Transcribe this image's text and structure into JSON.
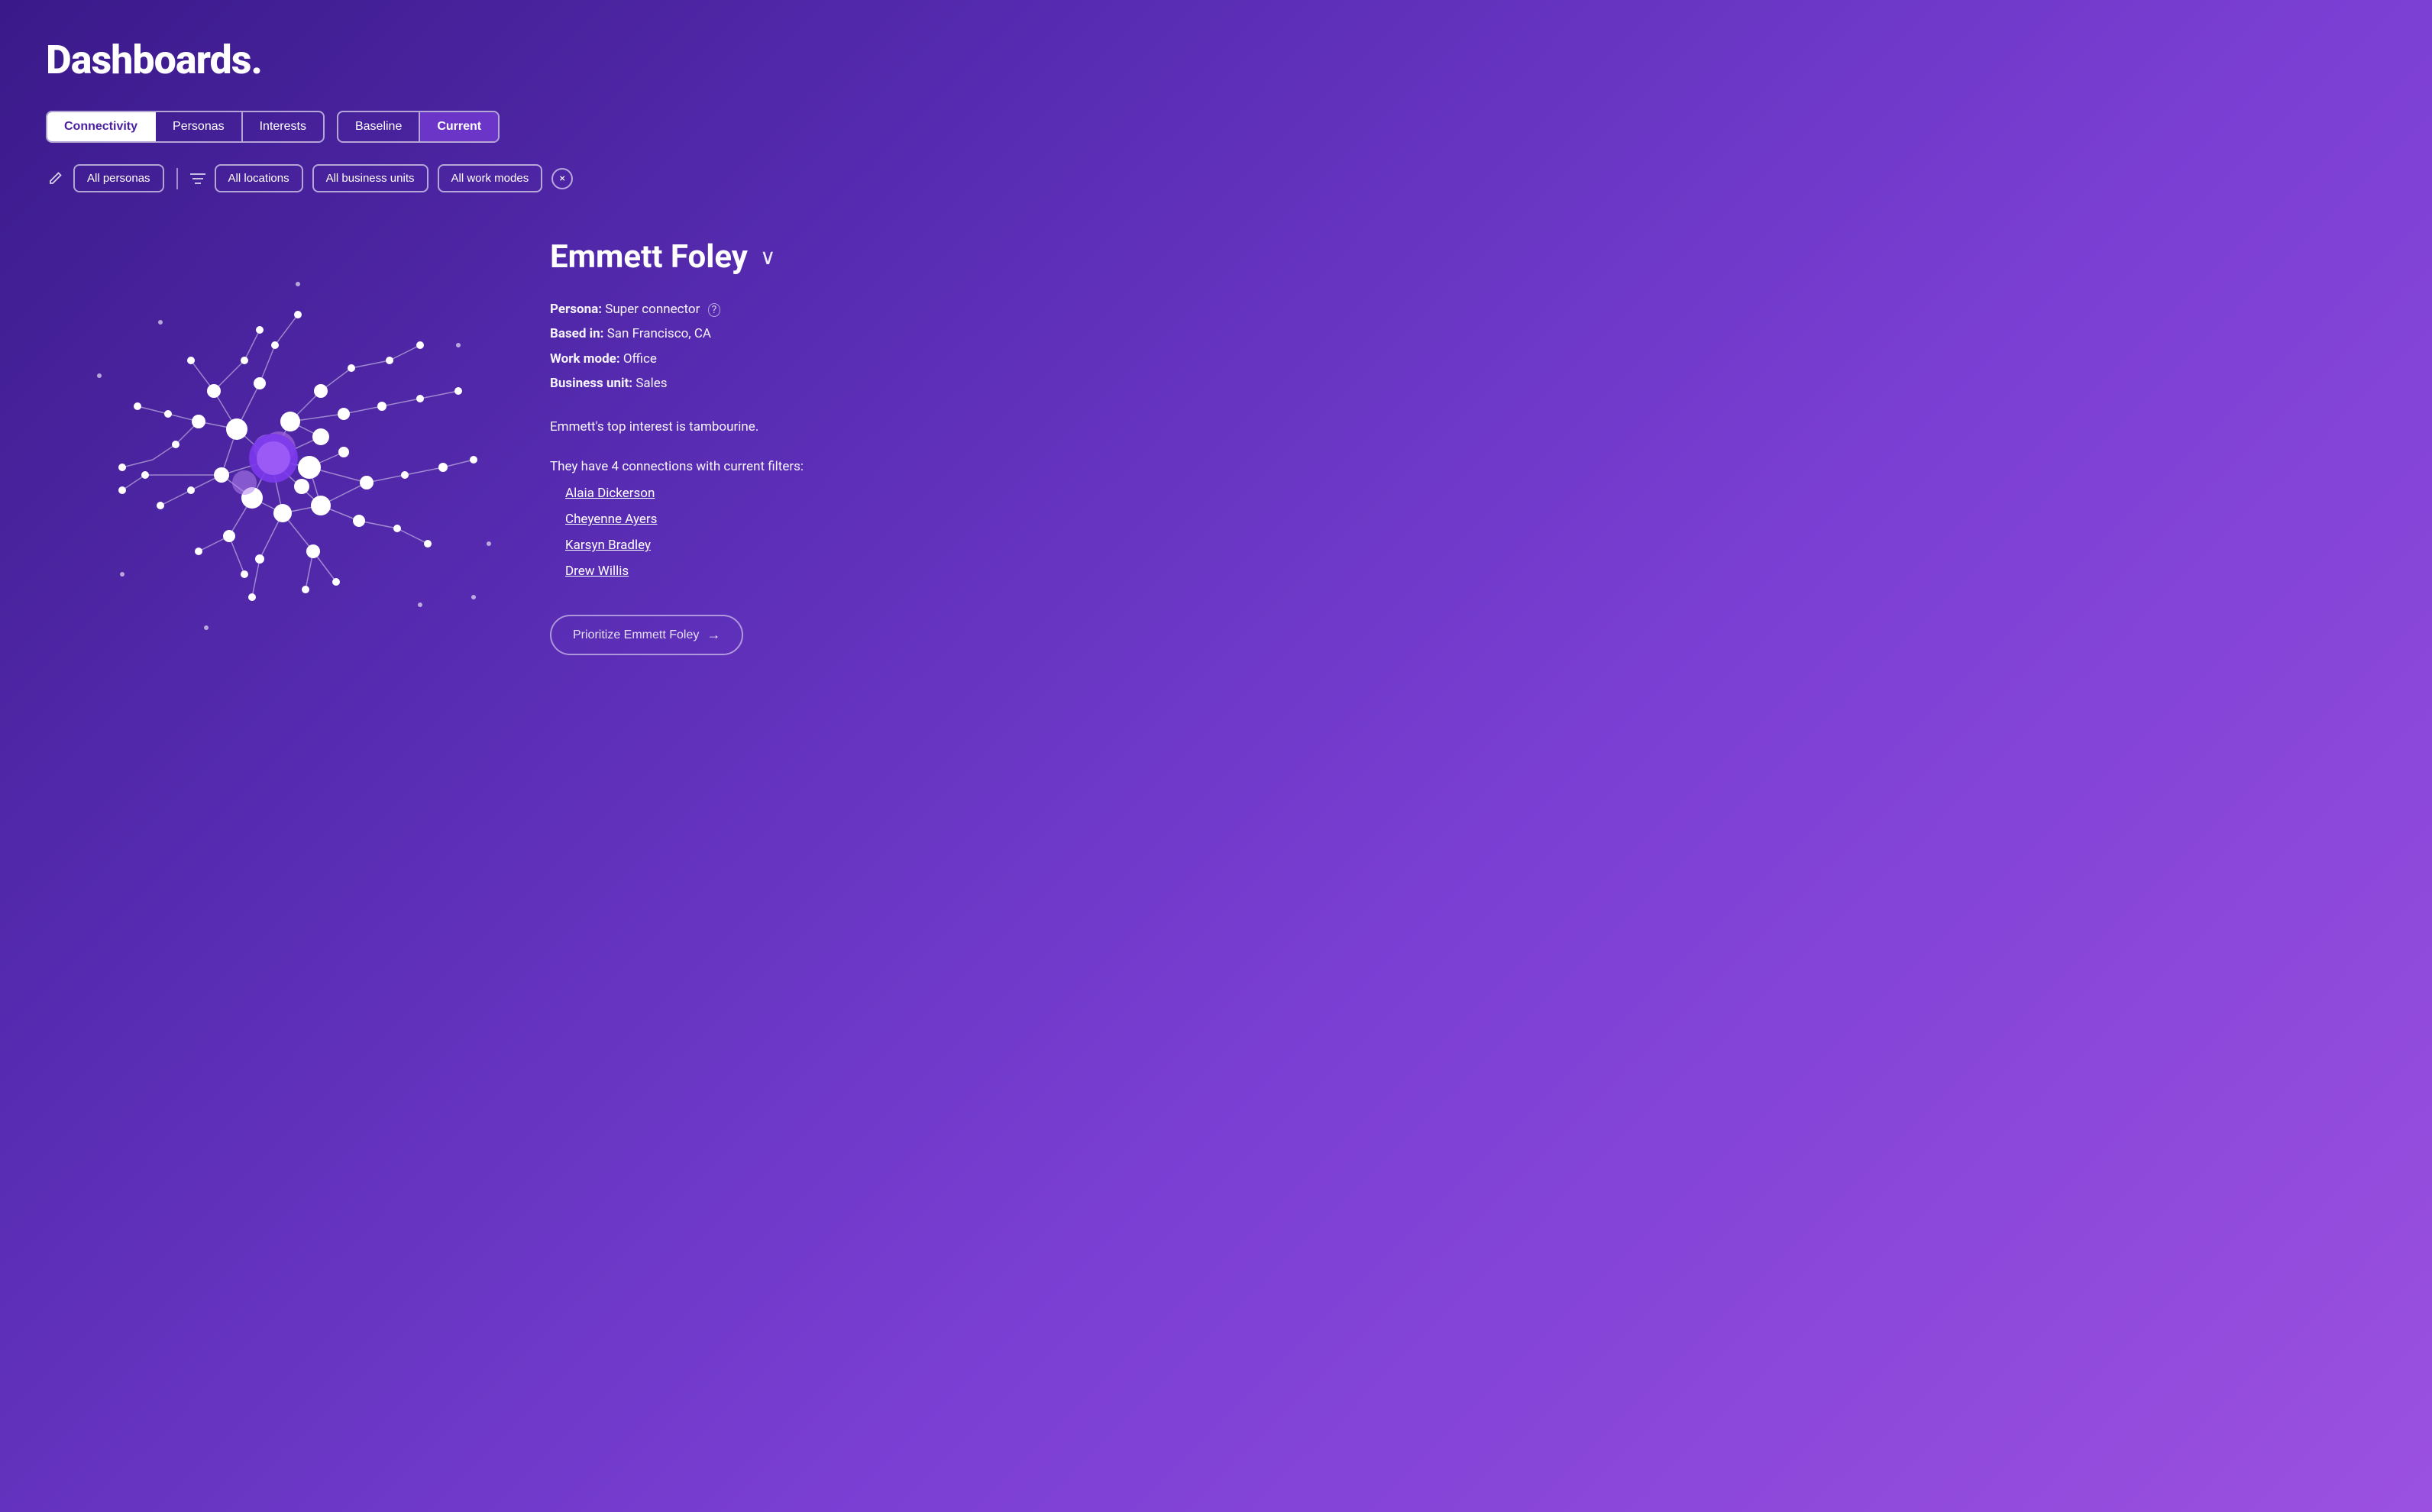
{
  "page": {
    "title": "Dashboards."
  },
  "tabs_group1": {
    "items": [
      {
        "id": "connectivity",
        "label": "Connectivity",
        "active": true
      },
      {
        "id": "personas",
        "label": "Personas",
        "active": false
      },
      {
        "id": "interests",
        "label": "Interests",
        "active": false
      }
    ]
  },
  "tabs_group2": {
    "items": [
      {
        "id": "baseline",
        "label": "Baseline",
        "active": false
      },
      {
        "id": "current",
        "label": "Current",
        "active": true
      }
    ]
  },
  "filters": {
    "personas_label": "All personas",
    "locations_label": "All locations",
    "business_units_label": "All business units",
    "work_modes_label": "All work modes"
  },
  "person": {
    "name": "Emmett Foley",
    "persona": "Super connector",
    "location": "San Francisco, CA",
    "work_mode": "Office",
    "business_unit": "Sales",
    "top_interest": "tambourine",
    "connections_count": 4,
    "connections": [
      {
        "name": "Alaia Dickerson"
      },
      {
        "name": "Cheyenne Ayers"
      },
      {
        "name": "Karsyn Bradley"
      },
      {
        "name": "Drew Willis"
      }
    ]
  },
  "labels": {
    "persona_label": "Persona:",
    "based_in_label": "Based in:",
    "work_mode_label": "Work mode:",
    "business_unit_label": "Business unit:",
    "interest_text_prefix": "Emmett's top interest is",
    "interest_text_suffix": ".",
    "connections_prefix": "They have",
    "connections_middle": "connections with current filters:",
    "prioritize_btn": "Prioritize Emmett Foley",
    "question_mark": "?",
    "info_icon": "ⓘ"
  }
}
